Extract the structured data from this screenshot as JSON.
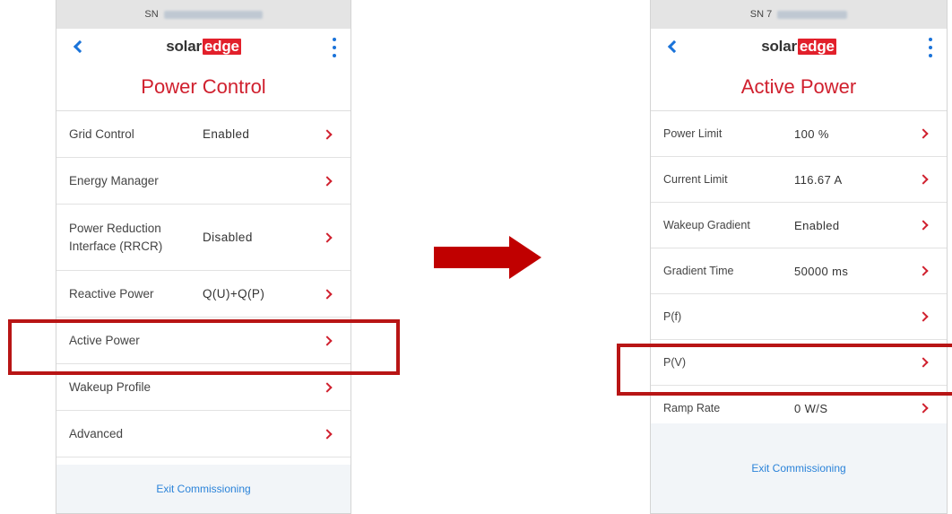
{
  "colors": {
    "accent": "#d0202e",
    "link": "#1a73d9",
    "highlight": "#b81515",
    "arrow": "#c00000",
    "footer_bg": "#f2f5f8"
  },
  "left": {
    "sn_label": "SN",
    "logo_part1": "solar",
    "logo_part2": "edge",
    "title": "Power Control",
    "items": [
      {
        "label": "Grid Control",
        "value": "Enabled"
      },
      {
        "label": "Energy Manager",
        "value": ""
      },
      {
        "label": "Power Reduction Interface (RRCR)",
        "value": "Disabled"
      },
      {
        "label": "Reactive Power",
        "value": "Q(U)+Q(P)"
      },
      {
        "label": "Active Power",
        "value": ""
      },
      {
        "label": "Wakeup Profile",
        "value": ""
      },
      {
        "label": "Advanced",
        "value": ""
      }
    ],
    "exit_label": "Exit Commissioning"
  },
  "right": {
    "sn_label": "SN 7",
    "logo_part1": "solar",
    "logo_part2": "edge",
    "title": "Active Power",
    "items": [
      {
        "label": "Power Limit",
        "value": "100 %"
      },
      {
        "label": "Current Limit",
        "value": "116.67 A"
      },
      {
        "label": "Wakeup Gradient",
        "value": "Enabled"
      },
      {
        "label": "Gradient Time",
        "value": "50000 ms"
      },
      {
        "label": "P(f)",
        "value": ""
      },
      {
        "label": "P(V)",
        "value": ""
      },
      {
        "label": "Ramp Rate",
        "value": "0 W/S"
      }
    ],
    "exit_label": "Exit Commissioning"
  }
}
